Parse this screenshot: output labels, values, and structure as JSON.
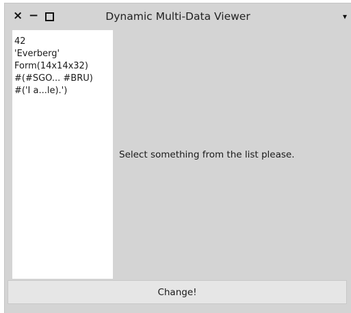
{
  "window": {
    "title": "Dynamic Multi-Data Viewer",
    "close_glyph": "×",
    "minimize_glyph": "−",
    "menu_glyph": "▾"
  },
  "list": {
    "items": [
      "42",
      "'Everberg'",
      "Form(14x14x32)",
      "#(#SGO... #BRU)",
      "#('I a...le).')"
    ]
  },
  "detail": {
    "message": "Select something from the list please."
  },
  "footer": {
    "button_label": "Change!"
  }
}
